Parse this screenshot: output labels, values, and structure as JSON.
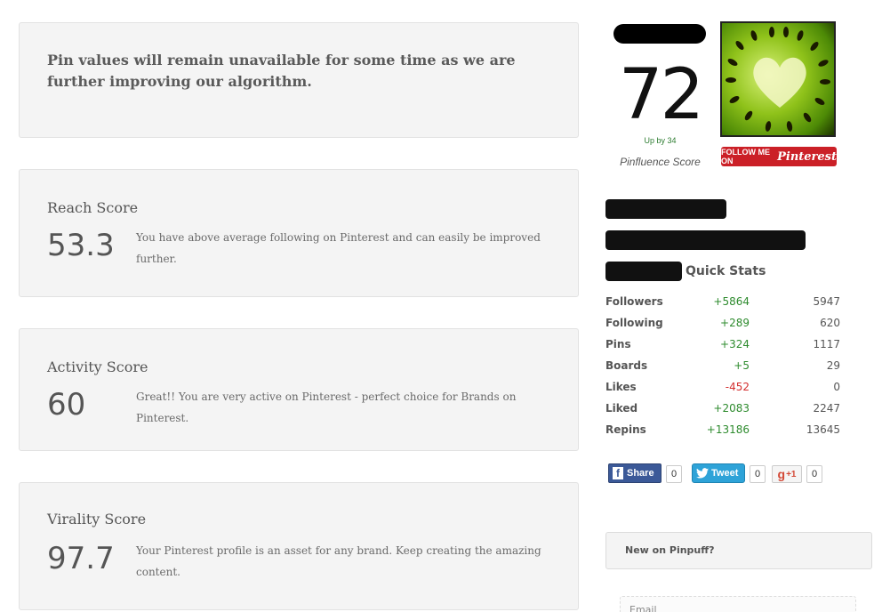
{
  "notice": {
    "text": "Pin values will remain unavailable for some time as we are further improving our algorithm."
  },
  "scores": [
    {
      "title": "Reach Score",
      "value": "53.3",
      "desc": "You have above average following on Pinterest and can easily be improved further."
    },
    {
      "title": "Activity Score",
      "value": "60",
      "desc": "Great!! You are very active on Pinterest - perfect choice for Brands on Pinterest."
    },
    {
      "title": "Virality Score",
      "value": "97.7",
      "desc": "Your Pinterest profile is an asset for any brand. Keep creating the amazing content."
    }
  ],
  "profile": {
    "pinfluence_value": "72",
    "up_by": "Up by 34",
    "pinfluence_label": "Pinfluence Score",
    "follow_button": {
      "prefix": "FOLLOW ME ON",
      "brand": "Pinterest"
    }
  },
  "quick_stats": {
    "title": "Quick Stats",
    "rows": [
      {
        "label": "Followers",
        "change": "+5864",
        "total": "5947",
        "trend": "pos"
      },
      {
        "label": "Following",
        "change": "+289",
        "total": "620",
        "trend": "pos"
      },
      {
        "label": "Pins",
        "change": "+324",
        "total": "1117",
        "trend": "pos"
      },
      {
        "label": "Boards",
        "change": "+5",
        "total": "29",
        "trend": "pos"
      },
      {
        "label": "Likes",
        "change": "-452",
        "total": "0",
        "trend": "neg"
      },
      {
        "label": "Liked",
        "change": "+2083",
        "total": "2247",
        "trend": "pos"
      },
      {
        "label": "Repins",
        "change": "+13186",
        "total": "13645",
        "trend": "pos"
      }
    ]
  },
  "social": {
    "facebook": {
      "label": "Share",
      "count": "0"
    },
    "twitter": {
      "label": "Tweet",
      "count": "0"
    },
    "gplus": {
      "label": "+1",
      "count": "0"
    }
  },
  "signup": {
    "heading": "New on Pinpuff?",
    "email_placeholder": "Email"
  },
  "colors": {
    "positive": "#2e8b2e",
    "negative": "#d32f2f",
    "pinterest_red": "#cb2027",
    "facebook_blue": "#3b5998",
    "twitter_blue": "#2ea3d8"
  }
}
